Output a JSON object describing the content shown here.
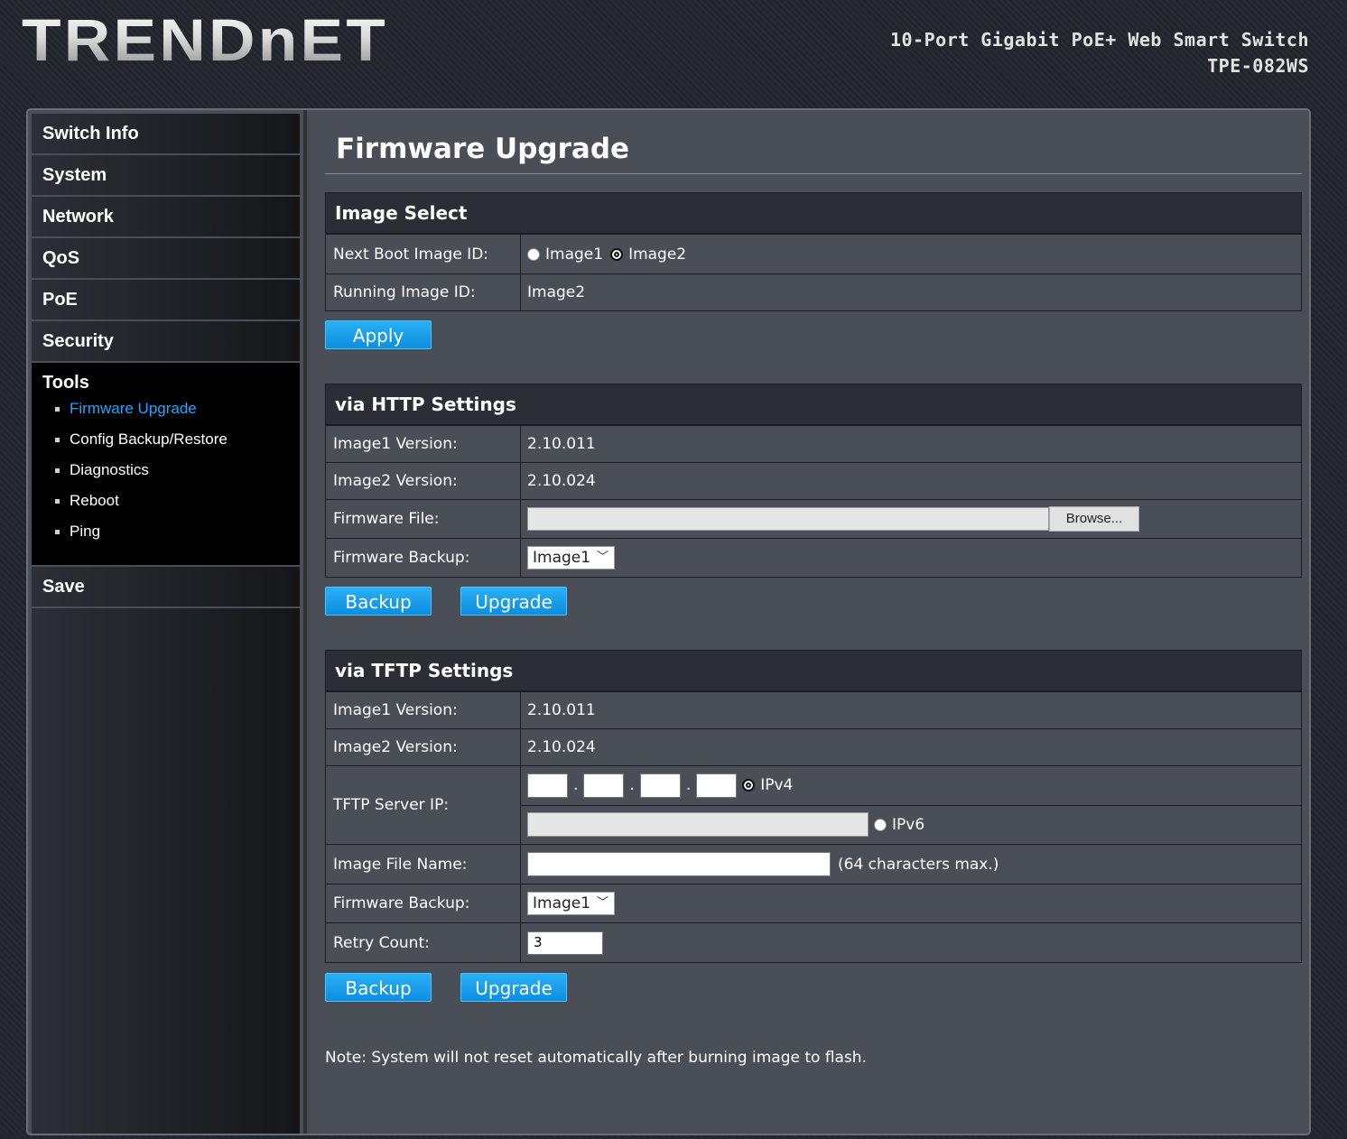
{
  "header": {
    "logo": "TRENDnET",
    "product_name": "10-Port Gigabit PoE+ Web Smart Switch",
    "model": "TPE-082WS"
  },
  "sidebar": {
    "items": [
      "Switch Info",
      "System",
      "Network",
      "QoS",
      "PoE",
      "Security"
    ],
    "tools": {
      "label": "Tools",
      "subitems": [
        "Firmware Upgrade",
        "Config Backup/Restore",
        "Diagnostics",
        "Reboot",
        "Ping"
      ],
      "active": "Firmware Upgrade"
    },
    "save": "Save"
  },
  "page": {
    "title": "Firmware Upgrade"
  },
  "image_select": {
    "heading": "Image Select",
    "next_boot_label": "Next Boot Image ID:",
    "option1": "Image1",
    "option2": "Image2",
    "selected": "Image2",
    "running_label": "Running Image ID:",
    "running_value": "Image2",
    "apply_label": "Apply"
  },
  "http": {
    "heading": "via HTTP Settings",
    "image1_label": "Image1 Version:",
    "image1_value": "2.10.011",
    "image2_label": "Image2 Version:",
    "image2_value": "2.10.024",
    "file_label": "Firmware File:",
    "browse_label": "Browse...",
    "backup_label": "Firmware Backup:",
    "backup_value": "Image1",
    "backup_button": "Backup",
    "upgrade_button": "Upgrade"
  },
  "tftp": {
    "heading": "via TFTP Settings",
    "image1_label": "Image1 Version:",
    "image1_value": "2.10.011",
    "image2_label": "Image2 Version:",
    "image2_value": "2.10.024",
    "server_label": "TFTP Server IP:",
    "ipv4_label": "IPv4",
    "ipv6_label": "IPv6",
    "ip_selected": "IPv4",
    "filename_label": "Image File Name:",
    "filename_hint": "(64 characters max.)",
    "backup_label": "Firmware Backup:",
    "backup_value": "Image1",
    "retry_label": "Retry Count:",
    "retry_value": "3",
    "backup_button": "Backup",
    "upgrade_button": "Upgrade"
  },
  "note": "Note: System will not reset automatically after burning image to flash."
}
